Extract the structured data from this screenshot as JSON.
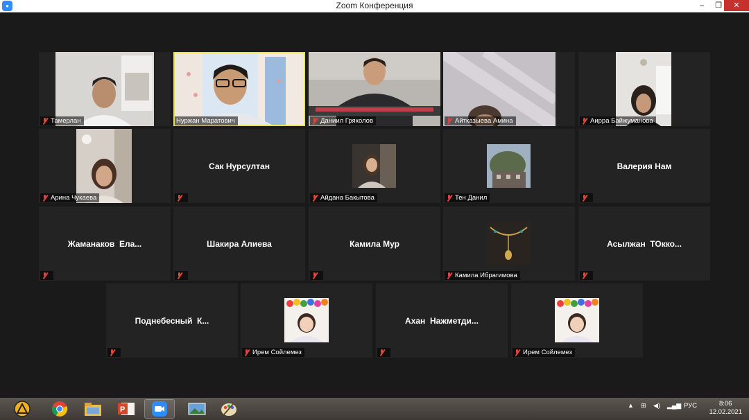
{
  "window": {
    "title": "Zoom Конференция",
    "controls": [
      "minimize-icon",
      "maximize-icon",
      "close-icon"
    ]
  },
  "participants": [
    {
      "name": "Тамерлан",
      "video": true,
      "muted": true,
      "active": false
    },
    {
      "name": "Нуржан Маратович",
      "video": true,
      "muted": false,
      "active": true
    },
    {
      "name": "Даниил Гряколов",
      "video": true,
      "muted": true,
      "active": false
    },
    {
      "name": "Айтказыева Амина",
      "video": true,
      "muted": true,
      "active": false
    },
    {
      "name": "Аирра Байжуманова",
      "video": true,
      "muted": true,
      "active": false
    },
    {
      "name": "Арина Чукаева",
      "video": true,
      "muted": true,
      "active": false
    },
    {
      "name": "Сак Нурсултан",
      "video": false,
      "muted": true,
      "active": false
    },
    {
      "name": "Айдана Бакытова",
      "video": "picture",
      "muted": true,
      "active": false
    },
    {
      "name": "Тен Данил",
      "video": "picture",
      "muted": true,
      "active": false
    },
    {
      "name": "Валерия Нам",
      "video": false,
      "muted": true,
      "active": false
    },
    {
      "name": "Жаманаков  Ела...",
      "video": false,
      "muted": true,
      "active": false
    },
    {
      "name": "Шакира Алиева",
      "video": false,
      "muted": true,
      "active": false
    },
    {
      "name": "Камила Мур",
      "video": false,
      "muted": true,
      "active": false
    },
    {
      "name": "Камила Ибрагимова",
      "video": "picture",
      "muted": true,
      "active": false
    },
    {
      "name": "Асылжан  ТОкко...",
      "video": false,
      "muted": true,
      "active": false
    },
    {
      "name": "Поднебесный  К...",
      "video": false,
      "muted": true,
      "active": false
    },
    {
      "name": "Ирем Сойлемез",
      "video": "picture",
      "muted": true,
      "active": false
    },
    {
      "name": "Ахан  Нажметди...",
      "video": false,
      "muted": true,
      "active": false
    },
    {
      "name": "Ирем Сойлемез",
      "video": "picture",
      "muted": true,
      "active": false
    }
  ],
  "taskbar": {
    "apps": [
      "chrome-icon",
      "file-explorer-icon",
      "powerpoint-icon",
      "zoom-icon",
      "photos-icon",
      "paint-icon"
    ],
    "open_app": "zoom-icon",
    "language": "РУС",
    "time": "8:06",
    "date": "12.02.2021"
  },
  "colors": {
    "active_speaker_border": "#e8e05a",
    "muted_mic": "#e0463c",
    "tile_bg": "#232323",
    "stage_bg": "#1a1a1a",
    "close_button": "#c7312d"
  }
}
